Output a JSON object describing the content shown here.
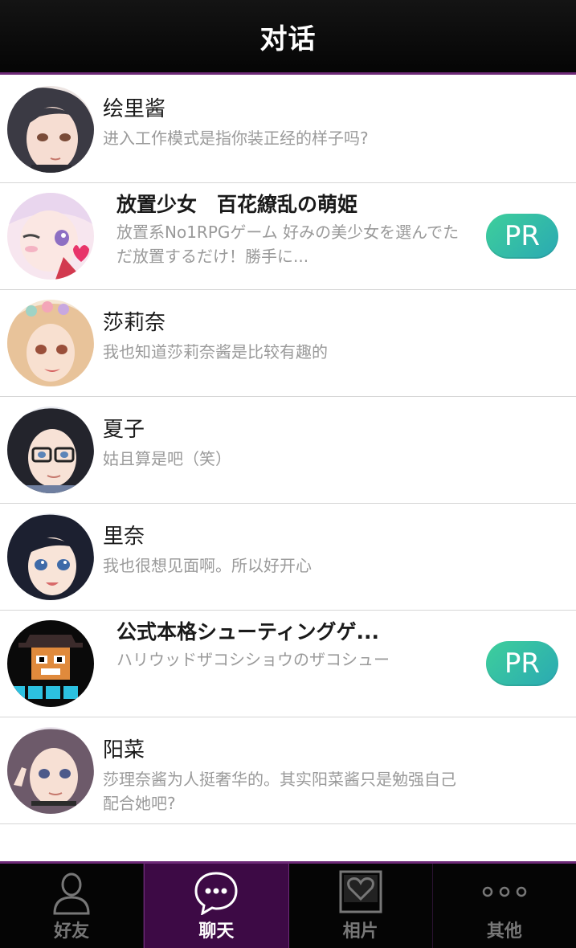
{
  "header": {
    "title": "对话"
  },
  "chats": [
    {
      "name": "绘里酱",
      "message": "进入工作模式是指你装正经的样子吗?",
      "pr": false
    },
    {
      "name": "放置少女　百花繚乱の萌姫",
      "message": "放置系No1RPGゲーム 好みの美少女を選んでただ放置するだけ！勝手に...",
      "pr": true,
      "badge": "PR"
    },
    {
      "name": "莎莉奈",
      "message": "我也知道莎莉奈酱是比较有趣的",
      "pr": false
    },
    {
      "name": "夏子",
      "message": "姑且算是吧（笑）",
      "pr": false
    },
    {
      "name": "里奈",
      "message": "我也很想见面啊。所以好开心",
      "pr": false
    },
    {
      "name": "公式本格シューティングゲ...",
      "message": "ハリウッドザコシショウのザコシュー",
      "pr": true,
      "badge": "PR"
    },
    {
      "name": "阳菜",
      "message": "莎理奈酱为人挺奢华的。其实阳菜酱只是勉强自己配合她吧?",
      "pr": false
    }
  ],
  "tabs": [
    {
      "label": "好友",
      "icon": "friend-icon",
      "active": false
    },
    {
      "label": "聊天",
      "icon": "chat-bubble-icon",
      "active": true
    },
    {
      "label": "相片",
      "icon": "heart-photo-icon",
      "active": false
    },
    {
      "label": "其他",
      "icon": "more-dots-icon",
      "active": false
    }
  ],
  "colors": {
    "accent": "#6e2a78",
    "pr_badge": "#3ecf9b",
    "active_tab": "#3d0a45"
  }
}
